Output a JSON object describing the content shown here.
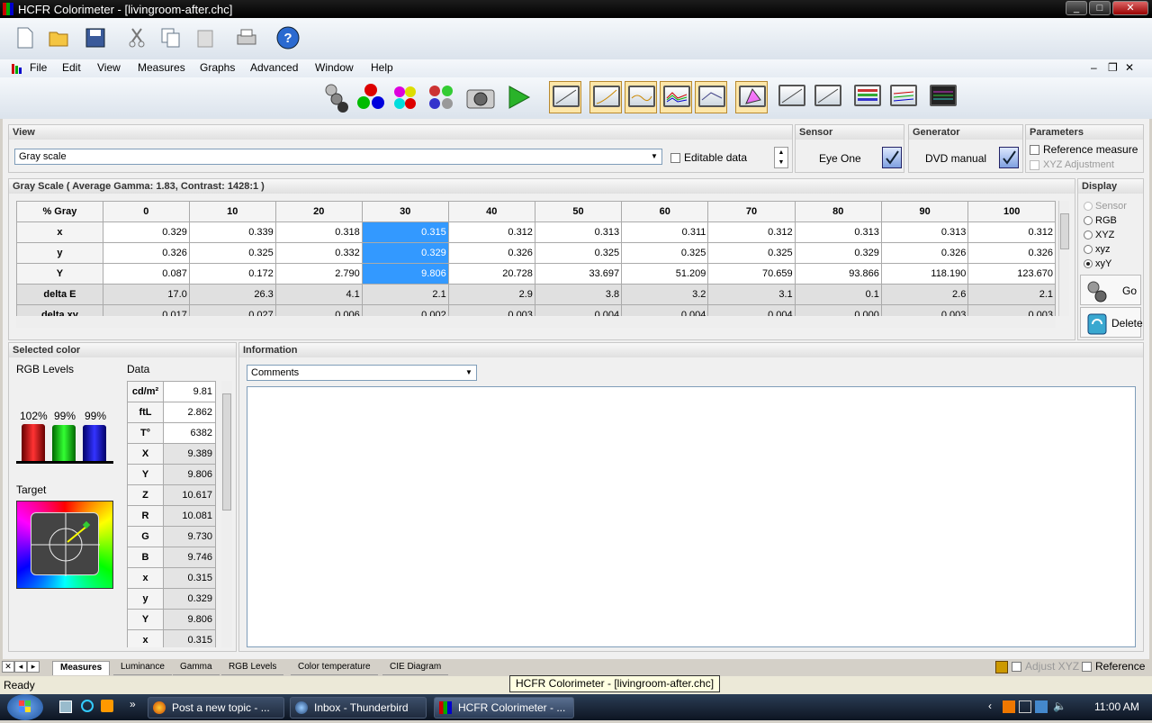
{
  "window": {
    "title": "HCFR Colorimeter - [livingroom-after.chc]"
  },
  "menu": [
    "File",
    "Edit",
    "View",
    "Measures",
    "Graphs",
    "Advanced",
    "Window",
    "Help"
  ],
  "view": {
    "title": "View",
    "selected": "Gray scale",
    "editable_label": "Editable data"
  },
  "sensor": {
    "title": "Sensor",
    "name": "Eye One"
  },
  "generator": {
    "title": "Generator",
    "name": "DVD manual"
  },
  "parameters": {
    "title": "Parameters",
    "reference": "Reference measure",
    "xyz_adj": "XYZ Adjustment"
  },
  "grayscale": {
    "title": "Gray Scale ( Average Gamma: 1.83, Contrast: 1428:1 )",
    "headers": [
      "% Gray",
      "0",
      "10",
      "20",
      "30",
      "40",
      "50",
      "60",
      "70",
      "80",
      "90",
      "100"
    ],
    "rows": [
      {
        "label": "x",
        "values": [
          "0.329",
          "0.339",
          "0.318",
          "0.315",
          "0.312",
          "0.313",
          "0.311",
          "0.312",
          "0.313",
          "0.313",
          "0.312"
        ]
      },
      {
        "label": "y",
        "values": [
          "0.326",
          "0.325",
          "0.332",
          "0.329",
          "0.326",
          "0.325",
          "0.325",
          "0.325",
          "0.329",
          "0.326",
          "0.326"
        ]
      },
      {
        "label": "Y",
        "values": [
          "0.087",
          "0.172",
          "2.790",
          "9.806",
          "20.728",
          "33.697",
          "51.209",
          "70.659",
          "93.866",
          "118.190",
          "123.670"
        ]
      },
      {
        "label": "delta E",
        "values": [
          "17.0",
          "26.3",
          "4.1",
          "2.1",
          "2.9",
          "3.8",
          "3.2",
          "3.1",
          "0.1",
          "2.6",
          "2.1"
        ]
      },
      {
        "label": "delta xy",
        "values": [
          "0.017",
          "0.027",
          "0.006",
          "0.002",
          "0.003",
          "0.004",
          "0.004",
          "0.004",
          "0.000",
          "0.003",
          "0.003"
        ]
      }
    ]
  },
  "display": {
    "title": "Display",
    "options": [
      "Sensor",
      "RGB",
      "XYZ",
      "xyz",
      "xyY"
    ],
    "selected": "xyY",
    "go": "Go",
    "delete": "Delete"
  },
  "selected_color": {
    "title": "Selected color",
    "rgb_levels": "RGB Levels",
    "data": "Data",
    "target": "Target",
    "pct": {
      "r": "102%",
      "g": "99%",
      "b": "99%"
    },
    "levels": {
      "r": 1.02,
      "g": 0.99,
      "b": 0.99
    },
    "rows": [
      {
        "label": "cd/m²",
        "value": "9.81"
      },
      {
        "label": "ftL",
        "value": "2.862"
      },
      {
        "label": "T°",
        "value": "6382"
      },
      {
        "label": "X",
        "value": "9.389"
      },
      {
        "label": "Y",
        "value": "9.806"
      },
      {
        "label": "Z",
        "value": "10.617"
      },
      {
        "label": "R",
        "value": "10.081"
      },
      {
        "label": "G",
        "value": "9.730"
      },
      {
        "label": "B",
        "value": "9.746"
      },
      {
        "label": "x",
        "value": "0.315"
      },
      {
        "label": "y",
        "value": "0.329"
      },
      {
        "label": "Y",
        "value": "9.806"
      },
      {
        "label": "x",
        "value": "0.315"
      }
    ]
  },
  "information": {
    "title": "Information",
    "selected": "Comments"
  },
  "tabs": [
    "Measures",
    "Luminance",
    "Gamma",
    "RGB Levels",
    "Color temperature",
    "CIE Diagram"
  ],
  "tooltip": "HCFR Colorimeter - [livingroom-after.chc]",
  "statusbar": {
    "text": "Ready",
    "adjust_xyz": "Adjust XYZ",
    "reference": "Reference"
  },
  "taskbar": {
    "tasks": [
      "Post a new topic - ...",
      "Inbox - Thunderbird",
      "HCFR Colorimeter - ..."
    ],
    "time": "11:00 AM"
  }
}
